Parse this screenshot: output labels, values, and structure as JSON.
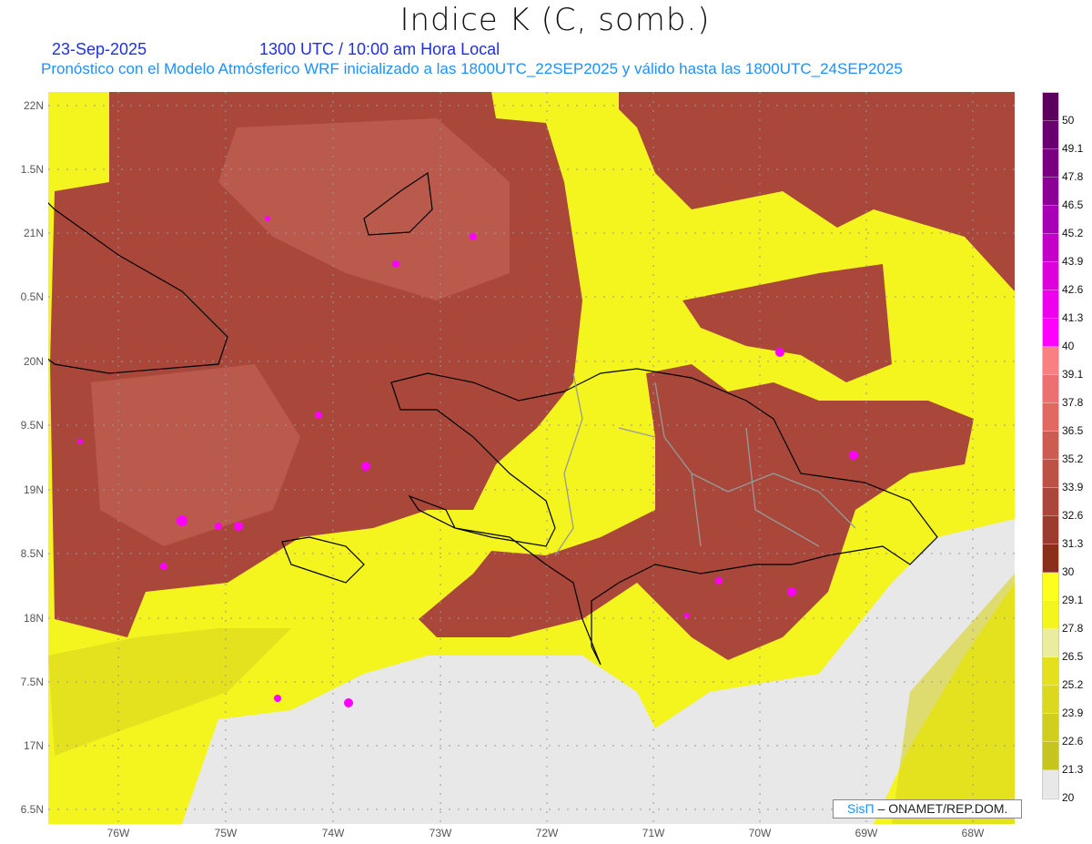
{
  "header": {
    "title": "Indice K (C, somb.)",
    "date": "23-Sep-2025",
    "time": "1300 UTC / 10:00 am Hora Local",
    "subtitle": "Pronóstico con el Modelo Atmósferico WRF inicializado a las 1800UTC_22SEP2025 y válido hasta las  1800UTC_24SEP2025"
  },
  "axes": {
    "lat_labels": [
      "22N",
      "1.5N",
      "21N",
      "0.5N",
      "20N",
      "9.5N",
      "19N",
      "8.5N",
      "18N",
      "7.5N",
      "17N",
      "6.5N"
    ],
    "lon_labels": [
      "76W",
      "75W",
      "74W",
      "73W",
      "72W",
      "71W",
      "70W",
      "69W",
      "68W"
    ]
  },
  "colorbar": {
    "labels": [
      "50",
      "49.1",
      "47.8",
      "46.5",
      "45.2",
      "43.9",
      "42.6",
      "41.3",
      "40",
      "39.1",
      "37.8",
      "36.5",
      "35.2",
      "33.9",
      "32.6",
      "31.3",
      "30",
      "29.1",
      "27.8",
      "26.5",
      "25.2",
      "23.9",
      "22.6",
      "21.3",
      "20"
    ],
    "colors": [
      "#5c0060",
      "#680070",
      "#78007e",
      "#8c0096",
      "#a800b4",
      "#c400c8",
      "#dc00dc",
      "#ee00ee",
      "#ff00ff",
      "#f88080",
      "#ec7070",
      "#e06a60",
      "#cc5c50",
      "#bc5244",
      "#a8473a",
      "#9c3c2c",
      "#8a3018",
      "#fefe1e",
      "#f4f41e",
      "#ececa0",
      "#e4e01e",
      "#dcd81e",
      "#d2ce1e",
      "#c6c41e",
      "#e8e8e8"
    ]
  },
  "credit": {
    "brand": "SisΠ",
    "org": "– ONAMET/REP.DOM."
  }
}
